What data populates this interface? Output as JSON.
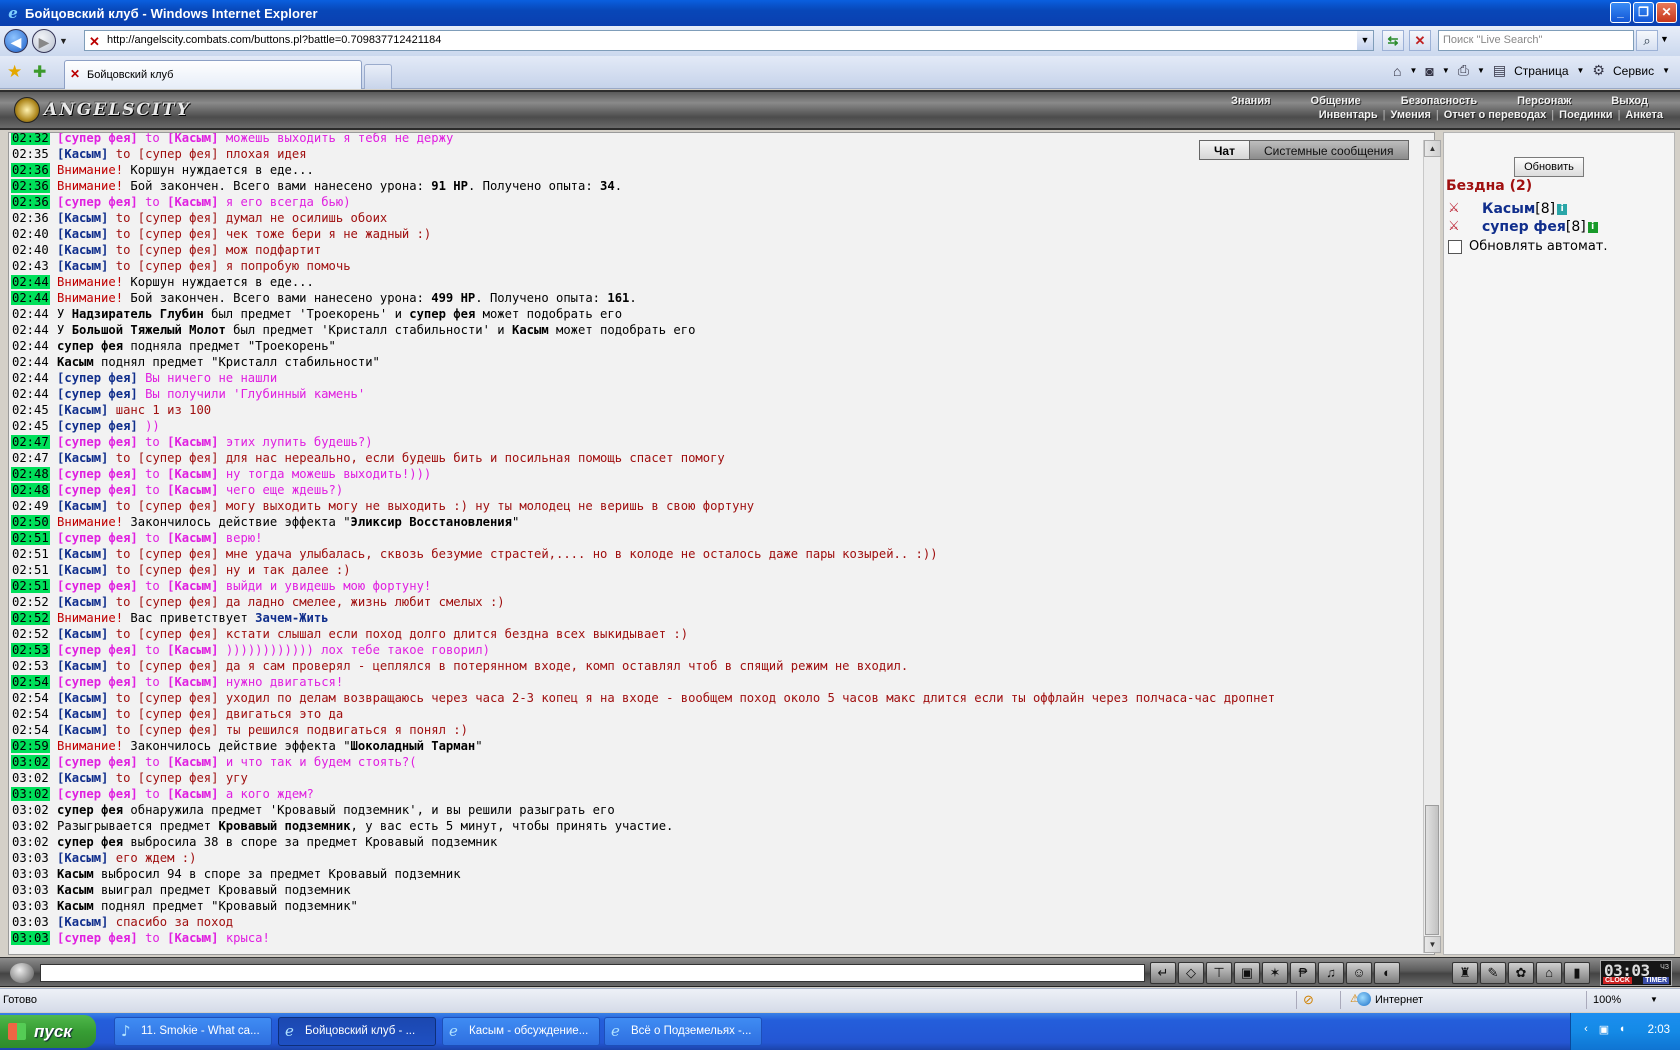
{
  "window": {
    "title": "Бойцовский клуб - Windows Internet Explorer"
  },
  "address_bar": {
    "url": "http://angelscity.combats.com/buttons.pl?battle=0.709837712421184",
    "search_placeholder": "Поиск \"Live Search\""
  },
  "tabs": {
    "active_label": "Бойцовский клуб"
  },
  "command_bar": {
    "page_label": "Страница",
    "tools_label": "Сервис"
  },
  "game_header": {
    "logo_text": "ANGELSCITY",
    "menu_top": [
      "Знания",
      "Общение",
      "Безопасность",
      "Персонаж",
      "Выход"
    ],
    "menu_bottom": [
      "Инвентарь",
      "Умения",
      "Отчет о переводах",
      "Поединки",
      "Анкета"
    ]
  },
  "chat": {
    "tabs": [
      "Чат",
      "Системные сообщения"
    ],
    "lines": [
      {
        "time": "02:32",
        "hl": true,
        "kind": "pm",
        "from": "супер фея",
        "to": "Касым",
        "text": "можешь выходить я тебя не держу"
      },
      {
        "time": "02:35",
        "hl": false,
        "kind": "say",
        "from": "Касым",
        "to": "супер фея",
        "text": "плохая идея"
      },
      {
        "time": "02:36",
        "hl": true,
        "kind": "warn",
        "text": "Коршун нуждается в еде..."
      },
      {
        "time": "02:36",
        "hl": true,
        "kind": "warn",
        "text": "Бой закончен. Всего вами нанесено урона: ",
        "b1": "91 HP",
        "text2": ". Получено опыта: ",
        "b2": "34",
        "text3": "."
      },
      {
        "time": "02:36",
        "hl": true,
        "kind": "pm",
        "from": "супер фея",
        "to": "Касым",
        "text": "я его всегда бью)"
      },
      {
        "time": "02:36",
        "hl": false,
        "kind": "say",
        "from": "Касым",
        "to": "супер фея",
        "text": "думал не осилишь обоих"
      },
      {
        "time": "02:40",
        "hl": false,
        "kind": "say",
        "from": "Касым",
        "to": "супер фея",
        "text": "чек тоже бери я не жадный :)"
      },
      {
        "time": "02:40",
        "hl": false,
        "kind": "say",
        "from": "Касым",
        "to": "супер фея",
        "text": "мож подфартит"
      },
      {
        "time": "02:43",
        "hl": false,
        "kind": "say",
        "from": "Касым",
        "to": "супер фея",
        "text": "я попробую помочь"
      },
      {
        "time": "02:44",
        "hl": true,
        "kind": "warn",
        "text": "Коршун нуждается в еде..."
      },
      {
        "time": "02:44",
        "hl": true,
        "kind": "warn",
        "text": "Бой закончен. Всего вами нанесено урона: ",
        "b1": "499 HP",
        "text2": ". Получено опыта: ",
        "b2": "161",
        "text3": "."
      },
      {
        "time": "02:44",
        "hl": false,
        "kind": "sys",
        "parts": [
          [
            "n",
            "У "
          ],
          [
            "b",
            "Надзиратель Глубин"
          ],
          [
            "n",
            " был предмет 'Троекорень' и "
          ],
          [
            "b",
            "супер фея"
          ],
          [
            "n",
            " может подобрать его"
          ]
        ]
      },
      {
        "time": "02:44",
        "hl": false,
        "kind": "sys",
        "parts": [
          [
            "n",
            "У "
          ],
          [
            "b",
            "Большой Тяжелый Молот"
          ],
          [
            "n",
            " был предмет 'Кристалл стабильности' и "
          ],
          [
            "b",
            "Касым"
          ],
          [
            "n",
            " может подобрать его"
          ]
        ]
      },
      {
        "time": "02:44",
        "hl": false,
        "kind": "sys",
        "parts": [
          [
            "b",
            "супер фея"
          ],
          [
            "n",
            " подняла предмет \"Троекорень\""
          ]
        ]
      },
      {
        "time": "02:44",
        "hl": false,
        "kind": "sys",
        "parts": [
          [
            "b",
            "Касым"
          ],
          [
            "n",
            " поднял предмет \"Кристалл стабильности\""
          ]
        ]
      },
      {
        "time": "02:44",
        "hl": false,
        "kind": "self",
        "from": "супер фея",
        "text": "Вы ничего не нашли"
      },
      {
        "time": "02:44",
        "hl": false,
        "kind": "self",
        "from": "супер фея",
        "text": "Вы получили 'Глубинный камень'"
      },
      {
        "time": "02:45",
        "hl": false,
        "kind": "selfd",
        "from": "Касым",
        "text": "шанс 1 из 100"
      },
      {
        "time": "02:45",
        "hl": false,
        "kind": "self",
        "from": "супер фея",
        "text": "))"
      },
      {
        "time": "02:47",
        "hl": true,
        "kind": "pm",
        "from": "супер фея",
        "to": "Касым",
        "text": "этих лупить будешь?)"
      },
      {
        "time": "02:47",
        "hl": false,
        "kind": "say",
        "from": "Касым",
        "to": "супер фея",
        "text": "для нас нереально, если будешь бить и посильная помощь спасет помогу"
      },
      {
        "time": "02:48",
        "hl": true,
        "kind": "pm",
        "from": "супер фея",
        "to": "Касым",
        "text": "ну тогда можешь выходить!)))"
      },
      {
        "time": "02:48",
        "hl": true,
        "kind": "pm",
        "from": "супер фея",
        "to": "Касым",
        "text": "чего еще ждешь?)"
      },
      {
        "time": "02:49",
        "hl": false,
        "kind": "say",
        "from": "Касым",
        "to": "супер фея",
        "text": "могу выходить могу не выходить :) ну ты молодец не веришь в свою фортуну"
      },
      {
        "time": "02:50",
        "hl": true,
        "kind": "warn",
        "text": "Закончилось действие эффекта \"",
        "b1": "Эликсир Восстановления",
        "text2": "\""
      },
      {
        "time": "02:51",
        "hl": true,
        "kind": "pm",
        "from": "супер фея",
        "to": "Касым",
        "text": "верю!"
      },
      {
        "time": "02:51",
        "hl": false,
        "kind": "say",
        "from": "Касым",
        "to": "супер фея",
        "text": "мне удача улыбалась, сквозь безумие страстей,.... но в колоде не осталось даже пары козырей.. :))"
      },
      {
        "time": "02:51",
        "hl": false,
        "kind": "say",
        "from": "Касым",
        "to": "супер фея",
        "text": "ну и так далее :)"
      },
      {
        "time": "02:51",
        "hl": true,
        "kind": "pm",
        "from": "супер фея",
        "to": "Касым",
        "text": "выйди и увидешь мою фортуну!"
      },
      {
        "time": "02:52",
        "hl": false,
        "kind": "say",
        "from": "Касым",
        "to": "супер фея",
        "text": "да ладно смелее, жизнь любит смелых :)"
      },
      {
        "time": "02:52",
        "hl": true,
        "kind": "greet",
        "text": "Вас приветствует ",
        "b1": "Зачем-Жить"
      },
      {
        "time": "02:52",
        "hl": false,
        "kind": "say",
        "from": "Касым",
        "to": "супер фея",
        "text": "кстати слышал если поход долго длится бездна всех выкидывает :)"
      },
      {
        "time": "02:53",
        "hl": true,
        "kind": "pm",
        "from": "супер фея",
        "to": "Касым",
        "text": ")))))))))))) лох тебе такое говорил)"
      },
      {
        "time": "02:53",
        "hl": false,
        "kind": "say",
        "from": "Касым",
        "to": "супер фея",
        "text": "да я сам проверял - цеплялся в потерянном входе, комп оставлял чтоб в спящий режим не входил."
      },
      {
        "time": "02:54",
        "hl": true,
        "kind": "pm",
        "from": "супер фея",
        "to": "Касым",
        "text": "нужно двигаться!"
      },
      {
        "time": "02:54",
        "hl": false,
        "kind": "say",
        "from": "Касым",
        "to": "супер фея",
        "text": "уходил по делам возвращаюсь через часа 2-3 копец я на входе - вообщем поход около 5 часов макс длится если ты оффлайн через полчаса-час дропнет"
      },
      {
        "time": "02:54",
        "hl": false,
        "kind": "say",
        "from": "Касым",
        "to": "супер фея",
        "text": "двигаться это да"
      },
      {
        "time": "02:54",
        "hl": false,
        "kind": "say",
        "from": "Касым",
        "to": "супер фея",
        "text": "ты решился подвигаться я понял :)"
      },
      {
        "time": "02:59",
        "hl": true,
        "kind": "warn",
        "text": "Закончилось действие эффекта \"",
        "b1": "Шоколадный Тарман",
        "text2": "\""
      },
      {
        "time": "03:02",
        "hl": true,
        "kind": "pm",
        "from": "супер фея",
        "to": "Касым",
        "text": "и что так и будем стоять?("
      },
      {
        "time": "03:02",
        "hl": false,
        "kind": "say",
        "from": "Касым",
        "to": "супер фея",
        "text": "угу"
      },
      {
        "time": "03:02",
        "hl": true,
        "kind": "pm",
        "from": "супер фея",
        "to": "Касым",
        "text": "а кого ждем?"
      },
      {
        "time": "03:02",
        "hl": false,
        "kind": "sys",
        "parts": [
          [
            "b",
            "супер фея"
          ],
          [
            "n",
            " обнаружила предмет 'Кровавый подземник', и вы решили разыграть его"
          ]
        ]
      },
      {
        "time": "03:02",
        "hl": false,
        "kind": "sys",
        "parts": [
          [
            "n",
            "Разыгрывается предмет "
          ],
          [
            "b",
            "Кровавый подземник"
          ],
          [
            "n",
            ", у вас есть 5 минут, чтобы принять участие."
          ]
        ]
      },
      {
        "time": "03:02",
        "hl": false,
        "kind": "sys",
        "parts": [
          [
            "b",
            "супер фея"
          ],
          [
            "n",
            " выбросила 38 в споре за предмет Кровавый подземник"
          ]
        ]
      },
      {
        "time": "03:03",
        "hl": false,
        "kind": "selfd",
        "from": "Касым",
        "text": "его ждем :)"
      },
      {
        "time": "03:03",
        "hl": false,
        "kind": "sys",
        "parts": [
          [
            "b",
            "Касым"
          ],
          [
            "n",
            " выбросил 94 в споре за предмет Кровавый подземник"
          ]
        ]
      },
      {
        "time": "03:03",
        "hl": false,
        "kind": "sys",
        "parts": [
          [
            "b",
            "Касым"
          ],
          [
            "n",
            " выиграл предмет Кровавый подземник"
          ]
        ]
      },
      {
        "time": "03:03",
        "hl": false,
        "kind": "sys",
        "parts": [
          [
            "b",
            "Касым"
          ],
          [
            "n",
            " поднял предмет \"Кровавый подземник\""
          ]
        ]
      },
      {
        "time": "03:03",
        "hl": false,
        "kind": "selfd",
        "from": "Касым",
        "text": "спасибо за поход"
      },
      {
        "time": "03:03",
        "hl": true,
        "kind": "pm",
        "from": "супер фея",
        "to": "Касым",
        "text": "крыса!"
      }
    ],
    "warn_word": "Внимание!",
    "to_word": "to"
  },
  "right_panel": {
    "refresh_button": "Обновить",
    "location": "Бездна (2)",
    "players": [
      {
        "name": "Касым",
        "level": "[8]",
        "info": "i"
      },
      {
        "name": "супер фея",
        "level": "[8]",
        "info": "i"
      }
    ],
    "auto_refresh_label": "Обновлять автомат."
  },
  "bottom_bar": {
    "clock_time": "03:03",
    "clock_unit": "ЧЗ",
    "clock_label": "CLOCK",
    "timer_label": "TIMER"
  },
  "status_bar": {
    "left": "Готово",
    "zone": "Интернет",
    "zoom": "100%"
  },
  "taskbar": {
    "start_label": "пуск",
    "items": [
      "11. Smokie - What ca...",
      "Бойцовский клуб - ...",
      "Касым - обсуждение...",
      "Всё о Подземельях -..."
    ],
    "clock": "2:03"
  },
  "colors": {
    "time_highlight": "#00e05a",
    "player_name": "#102e8c",
    "private_message": "#e020e0",
    "say_text": "#a01010",
    "warning": "#c00000"
  }
}
